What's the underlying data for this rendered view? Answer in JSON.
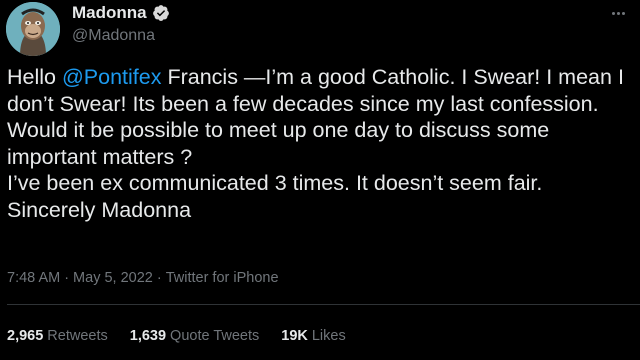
{
  "author": {
    "display_name": "Madonna",
    "handle": "@Madonna",
    "verified": true,
    "avatar_icon": "bored-ape-avatar"
  },
  "menu": {
    "more_icon": "more-dots-icon"
  },
  "tweet": {
    "text_before_mention": "Hello ",
    "mention": "@Pontifex",
    "text_after_mention": " Francis —I’m a good Catholic. I Swear! I mean I don’t Swear! Its been a few decades since my last confession. Would it  be possible to meet up one day to discuss some important matters ?\nI’ve been ex communicated 3 times. It doesn’t seem fair. Sincerely Madonna"
  },
  "meta": {
    "time": "7:48 AM",
    "sep1": "·",
    "date": "May 5, 2022",
    "sep2": "·",
    "source": "Twitter for iPhone"
  },
  "stats": {
    "retweets_count": "2,965",
    "retweets_label": "Retweets",
    "quotes_count": "1,639",
    "quotes_label": "Quote Tweets",
    "likes_count": "19K",
    "likes_label": "Likes"
  },
  "colors": {
    "background": "#000000",
    "text": "#e7e9ea",
    "secondary": "#71767b",
    "link": "#1d9bf0",
    "verified": "#1d9bf0"
  }
}
